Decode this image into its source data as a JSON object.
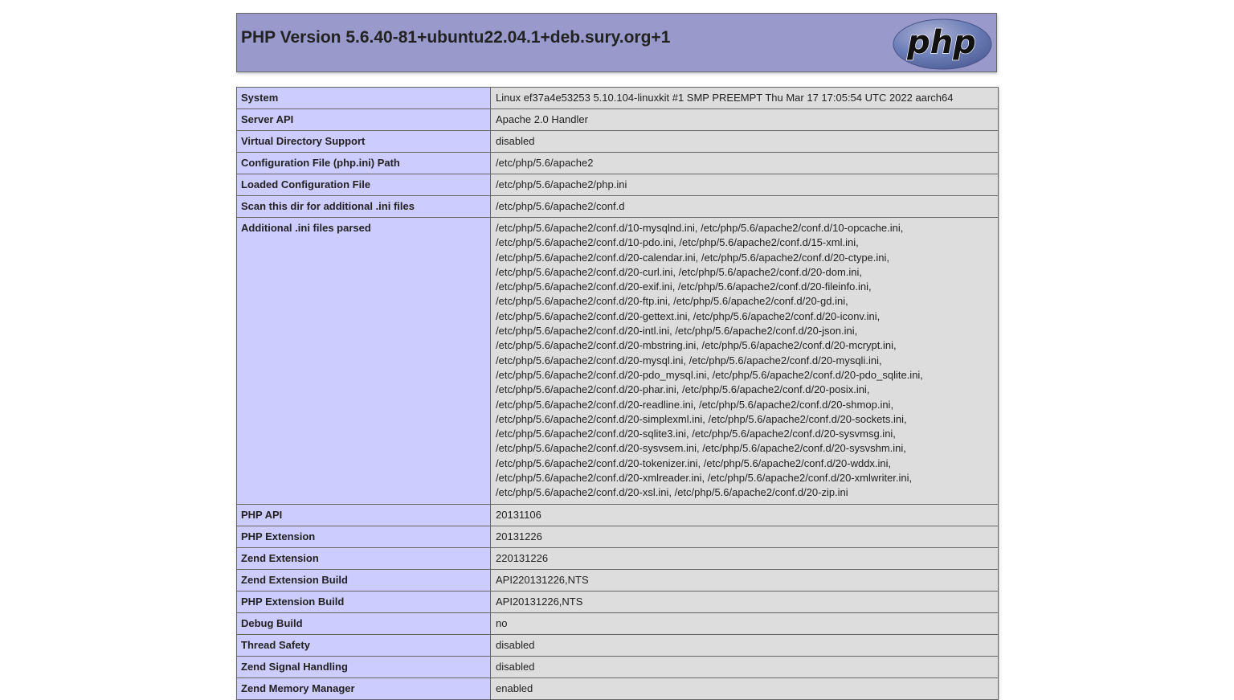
{
  "header": {
    "title": "PHP Version 5.6.40-81+ubuntu22.04.1+deb.sury.org+1",
    "logo_text": "php"
  },
  "colors": {
    "header_bg": "#9999cc",
    "label_bg": "#ccccff",
    "value_bg": "#dddddd",
    "border": "#666666"
  },
  "rows": [
    {
      "label": "System",
      "value": "Linux ef37a4e53253 5.10.104-linuxkit #1 SMP PREEMPT Thu Mar 17 17:05:54 UTC 2022 aarch64"
    },
    {
      "label": "Server API",
      "value": "Apache 2.0 Handler"
    },
    {
      "label": "Virtual Directory Support",
      "value": "disabled"
    },
    {
      "label": "Configuration File (php.ini) Path",
      "value": "/etc/php/5.6/apache2"
    },
    {
      "label": "Loaded Configuration File",
      "value": "/etc/php/5.6/apache2/php.ini"
    },
    {
      "label": "Scan this dir for additional .ini files",
      "value": "/etc/php/5.6/apache2/conf.d"
    }
  ],
  "additional_ini": {
    "label": "Additional .ini files parsed",
    "lines": [
      "/etc/php/5.6/apache2/conf.d/10-mysqlnd.ini, /etc/php/5.6/apache2/conf.d/10-opcache.ini,",
      "/etc/php/5.6/apache2/conf.d/10-pdo.ini, /etc/php/5.6/apache2/conf.d/15-xml.ini,",
      "/etc/php/5.6/apache2/conf.d/20-calendar.ini, /etc/php/5.6/apache2/conf.d/20-ctype.ini,",
      "/etc/php/5.6/apache2/conf.d/20-curl.ini, /etc/php/5.6/apache2/conf.d/20-dom.ini,",
      "/etc/php/5.6/apache2/conf.d/20-exif.ini, /etc/php/5.6/apache2/conf.d/20-fileinfo.ini,",
      "/etc/php/5.6/apache2/conf.d/20-ftp.ini, /etc/php/5.6/apache2/conf.d/20-gd.ini,",
      "/etc/php/5.6/apache2/conf.d/20-gettext.ini, /etc/php/5.6/apache2/conf.d/20-iconv.ini,",
      "/etc/php/5.6/apache2/conf.d/20-intl.ini, /etc/php/5.6/apache2/conf.d/20-json.ini,",
      "/etc/php/5.6/apache2/conf.d/20-mbstring.ini, /etc/php/5.6/apache2/conf.d/20-mcrypt.ini,",
      "/etc/php/5.6/apache2/conf.d/20-mysql.ini, /etc/php/5.6/apache2/conf.d/20-mysqli.ini,",
      "/etc/php/5.6/apache2/conf.d/20-pdo_mysql.ini, /etc/php/5.6/apache2/conf.d/20-pdo_sqlite.ini,",
      "/etc/php/5.6/apache2/conf.d/20-phar.ini, /etc/php/5.6/apache2/conf.d/20-posix.ini,",
      "/etc/php/5.6/apache2/conf.d/20-readline.ini, /etc/php/5.6/apache2/conf.d/20-shmop.ini,",
      "/etc/php/5.6/apache2/conf.d/20-simplexml.ini, /etc/php/5.6/apache2/conf.d/20-sockets.ini,",
      "/etc/php/5.6/apache2/conf.d/20-sqlite3.ini, /etc/php/5.6/apache2/conf.d/20-sysvmsg.ini,",
      "/etc/php/5.6/apache2/conf.d/20-sysvsem.ini, /etc/php/5.6/apache2/conf.d/20-sysvshm.ini,",
      "/etc/php/5.6/apache2/conf.d/20-tokenizer.ini, /etc/php/5.6/apache2/conf.d/20-wddx.ini,",
      "/etc/php/5.6/apache2/conf.d/20-xmlreader.ini, /etc/php/5.6/apache2/conf.d/20-xmlwriter.ini,",
      "/etc/php/5.6/apache2/conf.d/20-xsl.ini, /etc/php/5.6/apache2/conf.d/20-zip.ini"
    ]
  },
  "rows2": [
    {
      "label": "PHP API",
      "value": "20131106"
    },
    {
      "label": "PHP Extension",
      "value": "20131226"
    },
    {
      "label": "Zend Extension",
      "value": "220131226"
    },
    {
      "label": "Zend Extension Build",
      "value": "API220131226,NTS"
    },
    {
      "label": "PHP Extension Build",
      "value": "API20131226,NTS"
    },
    {
      "label": "Debug Build",
      "value": "no"
    },
    {
      "label": "Thread Safety",
      "value": "disabled"
    },
    {
      "label": "Zend Signal Handling",
      "value": "disabled"
    },
    {
      "label": "Zend Memory Manager",
      "value": "enabled"
    }
  ]
}
